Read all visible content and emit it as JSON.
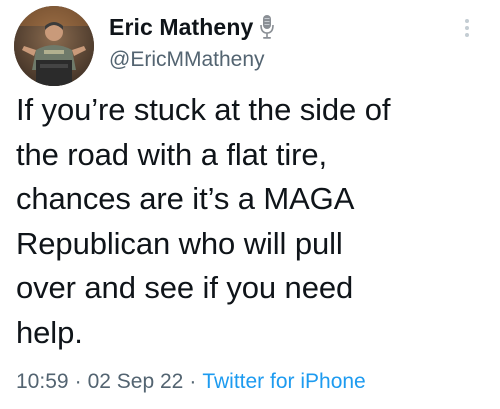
{
  "user": {
    "display_name": "Eric Matheny",
    "handle": "@EricMMatheny",
    "avatar_icon": "profile-photo",
    "badge_icon": "microphone-icon"
  },
  "tweet": {
    "text": "If you’re stuck at the side of\nthe road with a flat tire,\nchances are it’s a MAGA\nRepublican who will pull\nover and see if you need\nhelp.",
    "time": "10:59",
    "date": "02 Sep 22",
    "separator": "·",
    "source": "Twitter for iPhone"
  },
  "menu": {
    "icon": "more-options-icon"
  },
  "colors": {
    "text": "#0f1419",
    "secondary": "#536471",
    "link": "#1d9bf0",
    "background": "#ffffff"
  }
}
